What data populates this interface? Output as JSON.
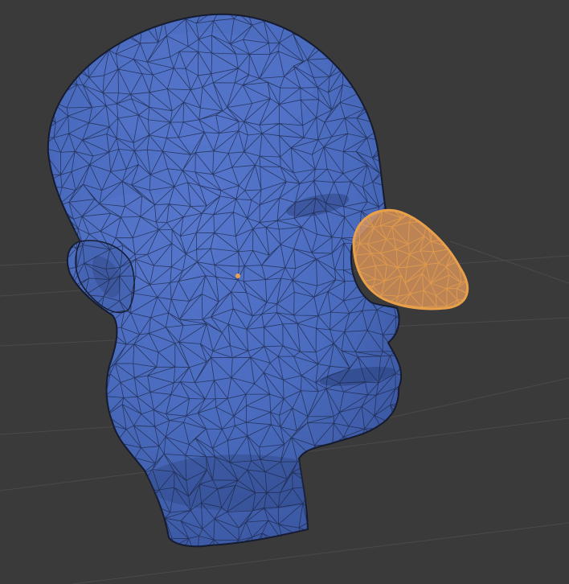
{
  "viewport": {
    "view": "3d-viewport",
    "mode": "edit-mesh",
    "background_color": "#3a3a3a",
    "grid_color": "#4a4a4a"
  },
  "mesh": {
    "object": "head",
    "display": "wireframe-overlay",
    "face_color": "#4a6cbf",
    "wire_color": "#1b2440"
  },
  "selection": {
    "region": "nose",
    "state": "selected",
    "color": "#e9a04a",
    "fill_color": "#d9955b"
  },
  "cursor": {
    "icon": "3d-cursor-icon",
    "color": "#e8a050"
  }
}
